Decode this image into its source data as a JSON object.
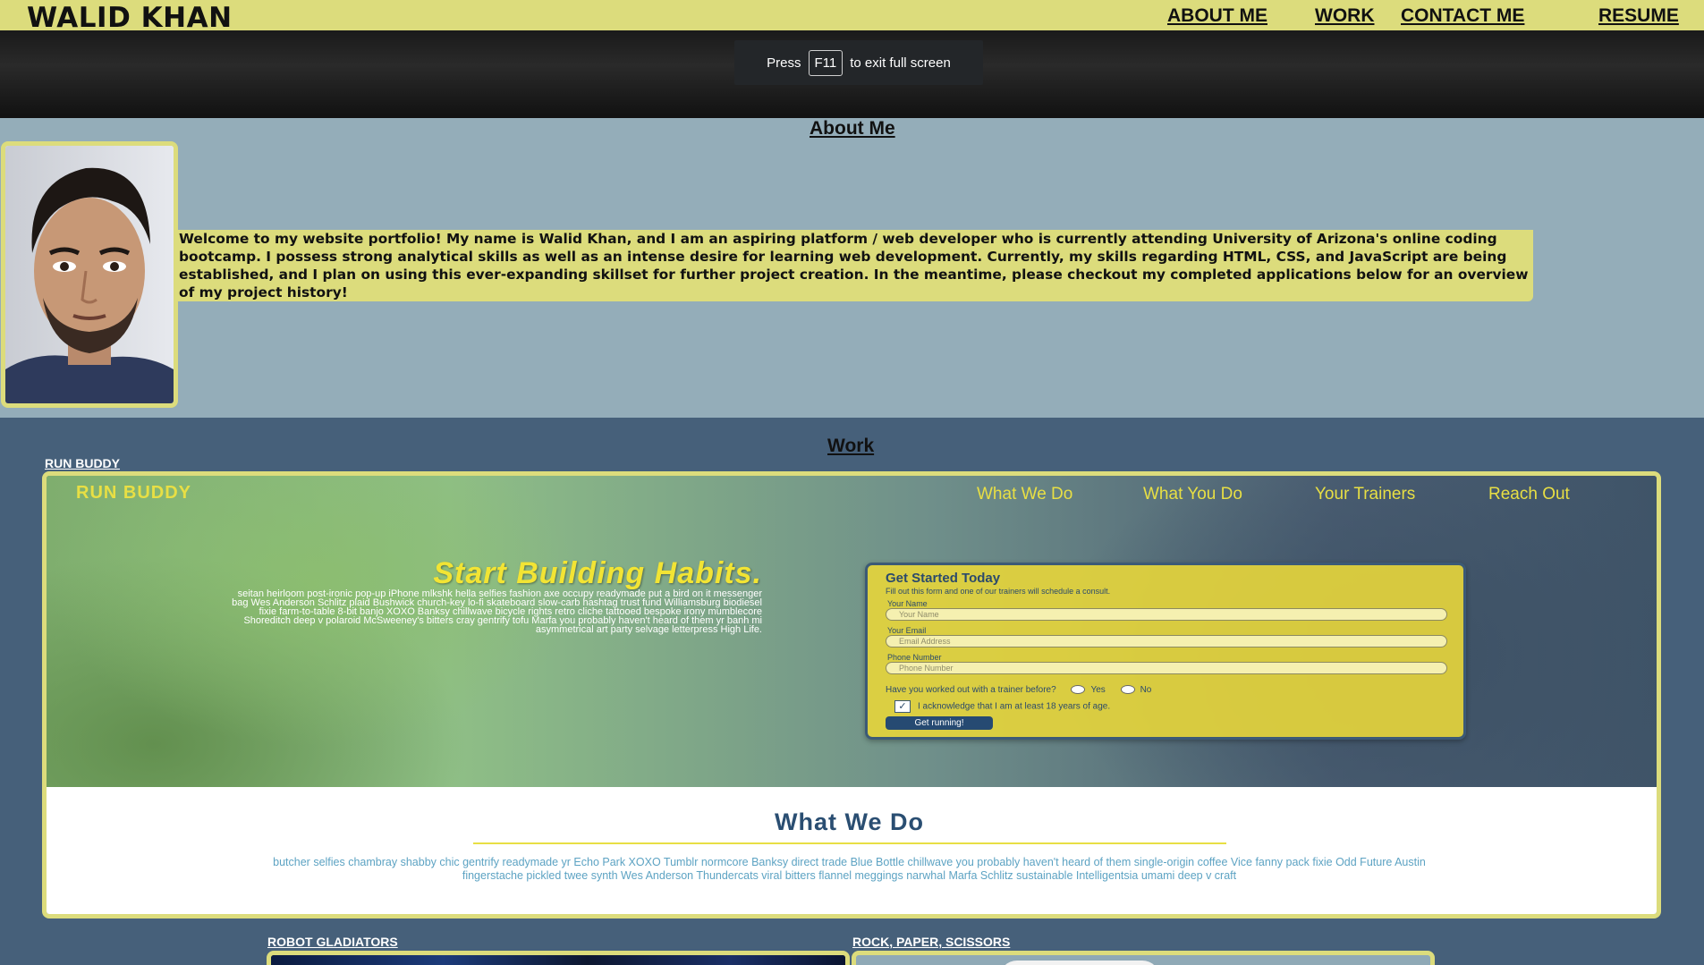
{
  "header": {
    "brand": "WALID KHAN",
    "nav": [
      {
        "label": "ABOUT ME"
      },
      {
        "label": "WORK"
      },
      {
        "label": "CONTACT ME"
      },
      {
        "label": "RESUME"
      }
    ]
  },
  "fullscreen_notice": {
    "prefix": "Press",
    "key": "F11",
    "suffix": "to exit full screen"
  },
  "about": {
    "title": "About Me",
    "text": "Welcome to my website portfolio! My name is Walid Khan, and I am an aspiring platform / web developer who is currently attending University of Arizona's online coding bootcamp. I possess strong analytical skills as well as an intense desire for learning web development. Currently, my skills regarding HTML, CSS, and JavaScript are being established, and I plan on using this ever-expanding skillset for further project creation. In the meantime, please checkout my completed applications below for an overview of my project history!"
  },
  "work": {
    "title": "Work",
    "projects": [
      {
        "label": "RUN BUDDY"
      },
      {
        "label": "ROBOT GLADIATORS"
      },
      {
        "label": "ROCK, PAPER, SCISSORS"
      }
    ]
  },
  "run_buddy_preview": {
    "brand": "RUN BUDDY",
    "nav": [
      "What We Do",
      "What You Do",
      "Your Trainers",
      "Reach Out"
    ],
    "headline": "Start Building Habits.",
    "blurb": "seitan heirloom post-ironic pop-up iPhone mlkshk hella selfies fashion axe occupy readymade put a bird on it messenger bag Wes Anderson Schlitz plaid Bushwick church-key lo-fi skateboard slow-carb hashtag trust fund Williamsburg biodiesel fixie farm-to-table 8-bit banjo XOXO Banksy chillwave bicycle rights retro cliche tattooed bespoke irony mumblecore Shoreditch deep v polaroid McSweeney's bitters cray gentrify tofu Marfa you probably haven't heard of them yr banh mi asymmetrical art party selvage letterpress High Life.",
    "form": {
      "title": "Get Started Today",
      "subtitle": "Fill out this form and one of our trainers will schedule a consult.",
      "name_label": "Your Name",
      "name_placeholder": "Your Name",
      "email_label": "Your Email",
      "email_placeholder": "Email Address",
      "phone_label": "Phone Number",
      "phone_placeholder": "Phone Number",
      "question": "Have you worked out with a trainer before?",
      "yes": "Yes",
      "no": "No",
      "acknowledge": "I acknowledge that I am at least 18 years of age.",
      "button": "Get running!"
    },
    "what_we_do_title": "What We Do",
    "what_we_do_text": "butcher selfies chambray shabby chic gentrify readymade yr Echo Park XOXO Tumblr normcore Banksy direct trade Blue Bottle chillwave you probably haven't heard of them single-origin coffee Vice fanny pack fixie Odd Future Austin fingerstache pickled twee synth Wes Anderson Thundercats viral bitters flannel meggings narwhal Marfa Schlitz sustainable Intelligentsia umami deep v craft"
  },
  "colors": {
    "header_bg": "#dcdc7c",
    "about_bg": "#94adb9",
    "work_bg": "#46607a",
    "accent_yellow": "#e8df44",
    "run_buddy_blue": "#2a4e72"
  }
}
